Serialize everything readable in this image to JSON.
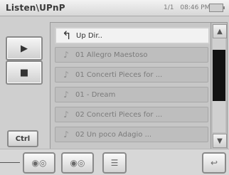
{
  "header": {
    "title": "Listen\\UPnP",
    "status_page": "1/1",
    "status_time": "08:46 PM",
    "battery_icon": "battery-icon"
  },
  "controls": {
    "play_icon": "play-icon",
    "stop_icon": "stop-icon",
    "ctrl_label": "Ctrl"
  },
  "list": {
    "items": [
      {
        "label": "Up Dir..",
        "icon": "up-dir-icon",
        "selected": true
      },
      {
        "label": "01 Allegro Maestoso",
        "icon": "music-note-icon"
      },
      {
        "label": "01 Concerti Pieces for ...",
        "icon": "music-note-icon"
      },
      {
        "label": "01 - Dream",
        "icon": "music-note-icon"
      },
      {
        "label": "02 Concerti Pieces for ...",
        "icon": "music-note-icon"
      },
      {
        "label": "02 Un poco Adagio ...",
        "icon": "music-note-icon"
      }
    ]
  },
  "bottom": {
    "b1_icon": "radio-icon",
    "b2_icon": "radio-icon",
    "b3_icon": "list-icon",
    "b4_icon": "exit-icon"
  }
}
